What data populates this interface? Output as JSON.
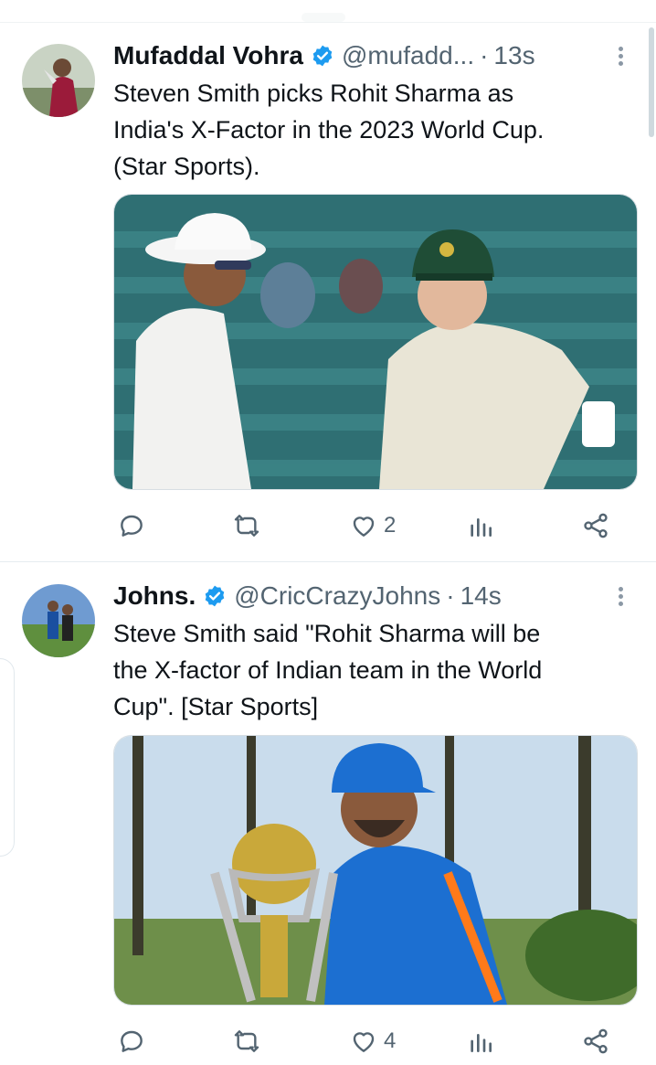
{
  "tweets": [
    {
      "name": "Mufaddal Vohra",
      "handle": "@mufadd...",
      "dot": "·",
      "time": "13s",
      "text_lines": [
        "Steven Smith picks Rohit Sharma as",
        "India's X-Factor in the 2023 World Cup.",
        "(Star Sports)."
      ],
      "likes": "2",
      "media_colors": {
        "stands": "#2f6f73",
        "seats": "#3f8a8c"
      }
    },
    {
      "name": "Johns.",
      "handle": "@CricCrazyJohns",
      "dot": "·",
      "time": "14s",
      "text_lines": [
        "Steve Smith said \"Rohit Sharma will be",
        "the X-factor of Indian team in the World",
        "Cup\". [Star Sports]"
      ],
      "likes": "4",
      "media_colors": {
        "sky": "#c9dcec",
        "jersey": "#1c6fd1"
      }
    }
  ],
  "icons": [
    "verified-badge-icon",
    "more-options-icon",
    "reply-icon",
    "retweet-icon",
    "like-icon",
    "views-icon",
    "share-icon"
  ],
  "colors": {
    "verified_blue": "#1d9bf0",
    "muted": "#536471",
    "text": "#0f1419"
  }
}
